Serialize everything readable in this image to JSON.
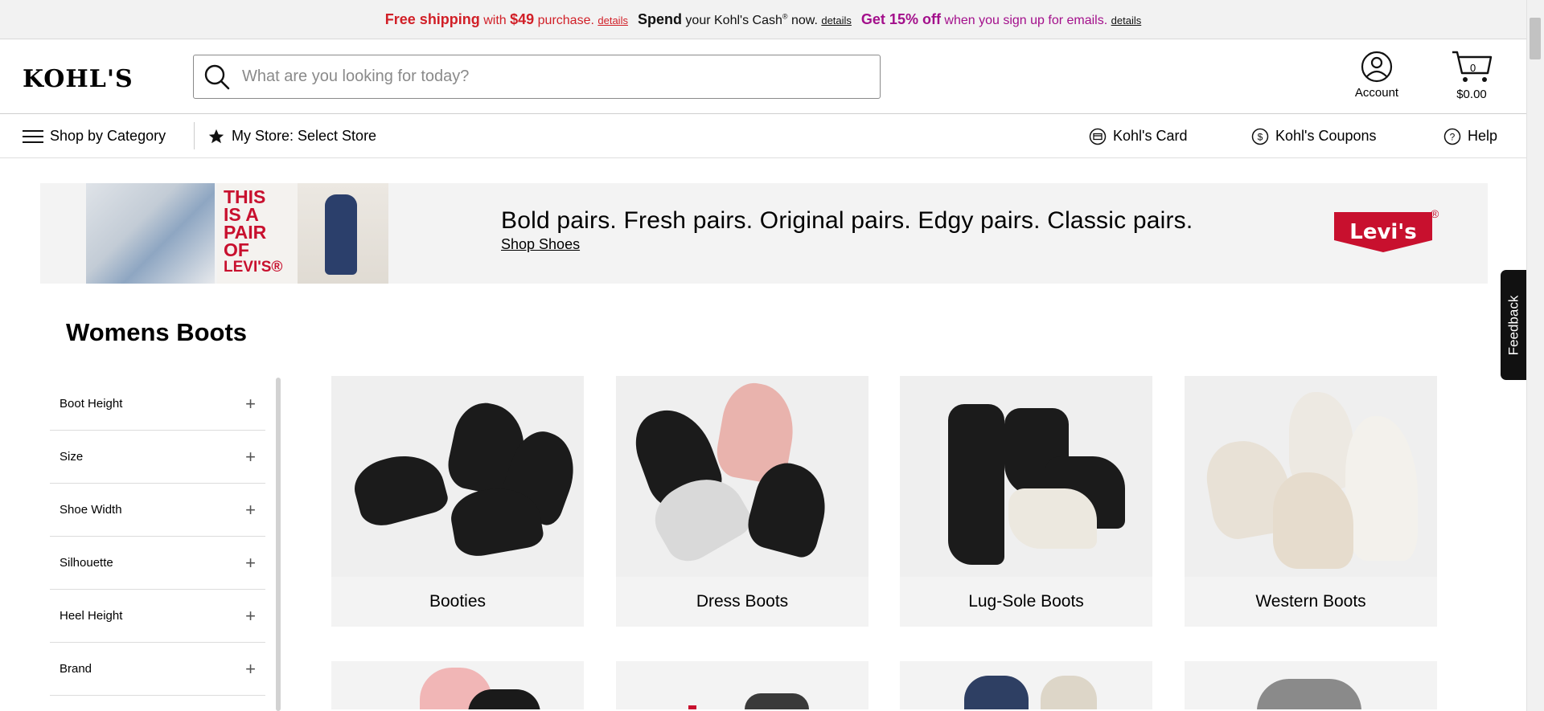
{
  "promo": {
    "free_shipping": "Free shipping",
    "with": "with",
    "amount": "$49",
    "purchase": "purchase.",
    "details1": "details",
    "spend": "Spend",
    "kohls_cash": "your Kohl's Cash",
    "reg": "®",
    "now": "now.",
    "details2": "details",
    "get_off": "Get 15% off",
    "signup": "when you sign up for emails.",
    "details3": "details"
  },
  "header": {
    "logo": "KOHL'S",
    "search_placeholder": "What are you looking for today?",
    "account_label": "Account",
    "cart_count": "0",
    "cart_total": "$0.00"
  },
  "nav": {
    "shop_by_category": "Shop by Category",
    "my_store": "My Store: Select Store",
    "kohls_card": "Kohl's Card",
    "kohls_coupons": "Kohl's Coupons",
    "help": "Help"
  },
  "banner": {
    "image_text": [
      "THIS",
      "IS A",
      "PAIR",
      "OF",
      "LEVI'S®"
    ],
    "headline": "Bold pairs. Fresh pairs. Original pairs. Edgy pairs. Classic pairs.",
    "cta": "Shop Shoes",
    "brand": "Levi's",
    "brand_mark": "®"
  },
  "page_title": "Womens Boots",
  "filters": [
    "Boot Height",
    "Size",
    "Shoe Width",
    "Silhouette",
    "Heel Height",
    "Brand"
  ],
  "categories": [
    "Booties",
    "Dress Boots",
    "Lug-Sole Boots",
    "Western Boots"
  ],
  "feedback_label": "Feedback",
  "colors": {
    "promo_red": "#d11f27",
    "promo_purple": "#a30f8b",
    "levis_red": "#c8102e"
  }
}
